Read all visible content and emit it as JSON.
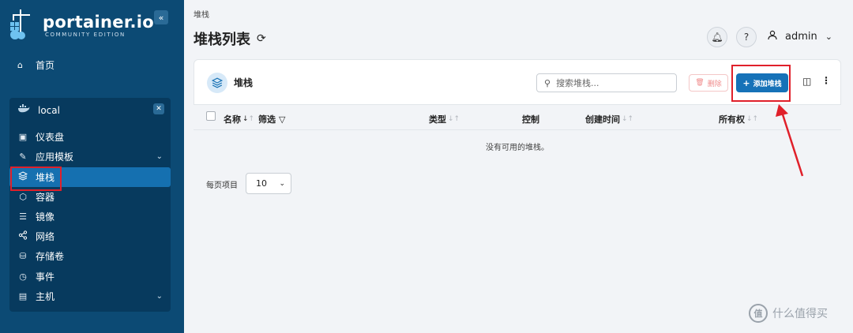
{
  "sidebar": {
    "logo_text": "portainer.io",
    "logo_sub": "COMMUNITY EDITION",
    "collapse_icon": "«",
    "home_label": "首页",
    "environment": "local",
    "items": [
      {
        "label": "仪表盘",
        "icon": "dashboard-icon"
      },
      {
        "label": "应用模板",
        "icon": "edit-icon",
        "chevron": true
      },
      {
        "label": "堆栈",
        "icon": "layers-icon",
        "active": true
      },
      {
        "label": "容器",
        "icon": "cube-icon"
      },
      {
        "label": "镜像",
        "icon": "list-icon"
      },
      {
        "label": "网络",
        "icon": "share-icon"
      },
      {
        "label": "存储卷",
        "icon": "database-icon"
      },
      {
        "label": "事件",
        "icon": "clock-icon"
      },
      {
        "label": "主机",
        "icon": "server-icon",
        "chevron": true
      }
    ]
  },
  "header": {
    "breadcrumb": "堆栈",
    "title": "堆栈列表",
    "user": "admin"
  },
  "card": {
    "title": "堆栈",
    "search_placeholder": "搜索堆栈...",
    "delete_label": "删除",
    "add_label": "添加堆栈"
  },
  "table": {
    "columns": {
      "name": "名称",
      "filter": "筛选",
      "type": "类型",
      "control": "控制",
      "created": "创建时间",
      "ownership": "所有权"
    },
    "empty_text": "没有可用的堆栈。"
  },
  "pagination": {
    "label": "每页项目",
    "value": "10"
  },
  "watermark": {
    "badge": "值",
    "text": "什么值得买"
  },
  "colors": {
    "sidebar_bg": "#0c4a74",
    "accent": "#1672b8",
    "highlight": "#e0202a"
  }
}
